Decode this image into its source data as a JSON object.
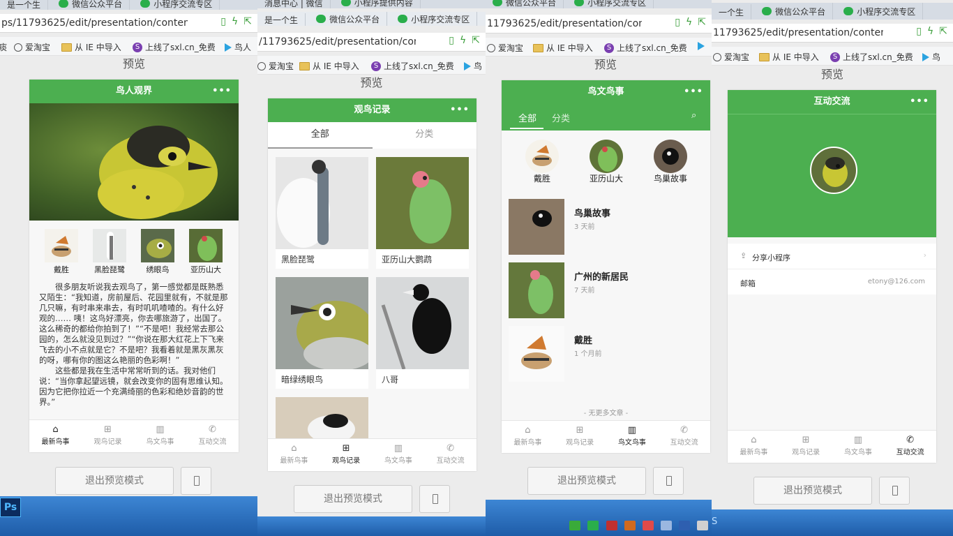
{
  "colors": {
    "accent": "#4caf50",
    "taskbar": "#2d6fc0"
  },
  "tabs": [
    {
      "label": "是一个生"
    },
    {
      "label": "微信公众平台"
    },
    {
      "label": "小程序交流专区"
    },
    {
      "label": "消息中心 | 微信"
    },
    {
      "label": "小程序提供内容"
    },
    {
      "label": "微信公众平台"
    },
    {
      "label": "小程序交流专区"
    },
    {
      "label": "微信公众平台"
    },
    {
      "label": "小程序交流专区"
    },
    {
      "label": "一个生"
    },
    {
      "label": "微信公众平台"
    },
    {
      "label": "小程序交流专区"
    }
  ],
  "browser": {
    "url1": "ps/11793625/edit/presentation/conten",
    "url2": "/11793625/edit/presentation/conten",
    "url3": "11793625/edit/presentation/conten",
    "url4": "11793625/edit/presentation/conten",
    "bm_frag": "痰",
    "bm_taobao": "爱淘宝",
    "bm_ie": "从 IE 中导入",
    "bm_sxl": "上线了sxl.cn_免费",
    "bm_bird": "鸟人",
    "bm_bird_short": "鸟"
  },
  "preview_label": "预览",
  "exit_label": "退出预览模式",
  "tabbar": [
    "最新鸟事",
    "观鸟记录",
    "鸟文鸟事",
    "互动交流"
  ],
  "panel1": {
    "title": "鸟人观界",
    "thumbs": [
      "戴胜",
      "黑脸琵鹭",
      "绣眼鸟",
      "亚历山大"
    ],
    "para1": "很多朋友听说我去观鸟了，第一感觉都是既熟悉又陌生：“我知道，房前屋后、花园里就有，不就是那几只嘛，有时串来串去，有时叽叽喳喳的。有什么好观的…… 咦！这鸟好漂亮，你去哪旅游了，出国了。这么稀奇的都给你拍到了！”“不是吧！我经常去那公园的，怎么就没见到过？”“你说在那大红花上下飞来飞去的小不点就是它？不是吧？我看着就是黑灰黑灰的呀，哪有你的图这么艳丽的色彩啊！”",
    "para2": "这些都是我在生活中常常听到的话。我对他们说：“当你拿起望远镜，就会改变你的固有思维认知。因为它把你拉近一个充满绮丽的色彩和绝妙音韵的世界。”"
  },
  "panel2": {
    "title": "观鸟记录",
    "seg": [
      "全部",
      "分类"
    ],
    "cards": [
      "黑脸琵鹭",
      "亚历山大鹦鹉",
      "暗绿绣眼鸟",
      "八哥"
    ]
  },
  "panel3": {
    "title": "鸟文鸟事",
    "filters": [
      "全部",
      "分类"
    ],
    "circles": [
      "戴胜",
      "亚历山大",
      "鸟巢故事"
    ],
    "items": [
      {
        "title": "鸟巢故事",
        "time": "3 天前"
      },
      {
        "title": "广州的新居民",
        "time": "7 天前"
      },
      {
        "title": "戴胜",
        "time": "1 个月前"
      }
    ],
    "no_more": "- 无更多文章 -"
  },
  "panel4": {
    "title": "互动交流",
    "share": "分享小程序",
    "email_label": "邮箱",
    "email_value": "etony@126.com"
  },
  "taskbar": {
    "ps": "Ps",
    "s": "S"
  }
}
